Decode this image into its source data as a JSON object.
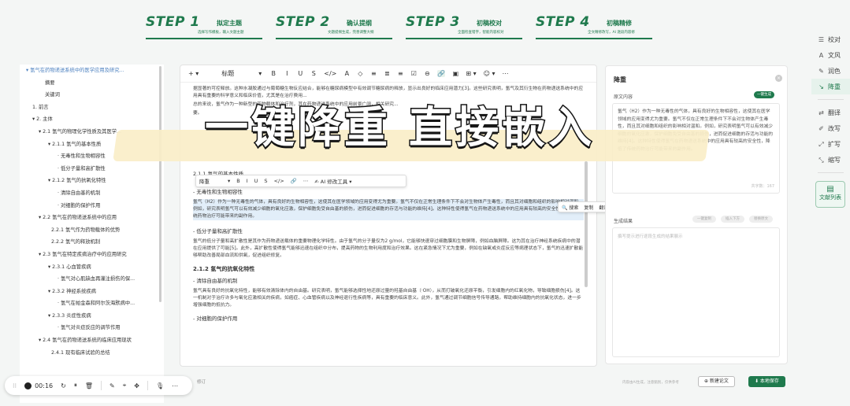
{
  "steps": [
    {
      "num": "STEP 1",
      "title": "拟定主题",
      "sub": "选择写作模板，输入文题主题"
    },
    {
      "num": "STEP 2",
      "title": "确认提纲",
      "sub": "文题提纲生成，完善调整大纲"
    },
    {
      "num": "STEP 3",
      "title": "初稿校对",
      "sub": "全面检查错字，智能内容校对"
    },
    {
      "num": "STEP 4",
      "title": "初稿精修",
      "sub": "全文精修改写，AI 逐段内容修"
    }
  ],
  "rail": {
    "items": [
      {
        "icon": "☰",
        "label": "校对"
      },
      {
        "icon": "A",
        "label": "文风"
      },
      {
        "icon": "✎",
        "label": "润色"
      },
      {
        "icon": "↘",
        "label": "降重"
      },
      {
        "icon": "⇄",
        "label": "翻译"
      },
      {
        "icon": "✐",
        "label": "改写"
      },
      {
        "icon": "⤢",
        "label": "扩写"
      },
      {
        "icon": "⤡",
        "label": "缩写"
      }
    ],
    "card_label": "文献列表"
  },
  "outline": {
    "items": [
      {
        "indent": 0,
        "text": "▾ 氢气在药物递送系统中的医学应用及研究..."
      },
      {
        "indent": 24,
        "text": "摘要"
      },
      {
        "indent": 24,
        "text": "关键词"
      },
      {
        "indent": 8,
        "text": "1. 前言"
      },
      {
        "indent": 8,
        "text": "▾ 2. 主体"
      },
      {
        "indent": 16,
        "text": "▾ 2.1 氢气的物理化学性质及其医学..."
      },
      {
        "indent": 28,
        "text": "▾ 2.1.1 氢气的基本性质"
      },
      {
        "indent": 40,
        "text": "· 无毒性和生物相容性"
      },
      {
        "indent": 40,
        "text": "· 低分子量和高扩散性"
      },
      {
        "indent": 28,
        "text": "▾ 2.1.2 氢气的抗氧化特性"
      },
      {
        "indent": 40,
        "text": "· 清除自由基的机制"
      },
      {
        "indent": 40,
        "text": "· 对细胞的保护作用"
      },
      {
        "indent": 16,
        "text": "▾ 2.2 氢气在药物递送系统中的应用"
      },
      {
        "indent": 32,
        "text": "2.2.1 氢气作为药物载体的优势"
      },
      {
        "indent": 32,
        "text": "2.2.2 氢气的释放机制"
      },
      {
        "indent": 16,
        "text": "▾ 2.3 氢气在特定疾病治疗中的应用研究"
      },
      {
        "indent": 28,
        "text": "▾ 2.3.1 心血管疾病"
      },
      {
        "indent": 40,
        "text": "· 氢气对心肌缺血再灌注损伤的保..."
      },
      {
        "indent": 28,
        "text": "▾ 2.3.2 神经系统疾病"
      },
      {
        "indent": 40,
        "text": "· 氢气在帕金森和阿尔茨海默病中..."
      },
      {
        "indent": 28,
        "text": "▾ 2.3.3 炎症性疾病"
      },
      {
        "indent": 40,
        "text": "· 氢气对炎症反应的调节作用"
      },
      {
        "indent": 16,
        "text": "▾ 2.4 氢气在药物递送系统的临床应用现状"
      },
      {
        "indent": 32,
        "text": "2.4.1 现有临床试验的总结"
      }
    ]
  },
  "toolbar": {
    "items": [
      "+ ▾",
      "标题",
      "▾",
      "B",
      "I",
      "U",
      "S",
      "</>",
      "A",
      "◇",
      "≡",
      "≣",
      "≡",
      "☑",
      "⊖",
      "🔗",
      "▣",
      "⊞ ▾",
      "☺ ▾",
      "⋯"
    ],
    "active_index": 15
  },
  "fbar": {
    "items": [
      "降重",
      "▾",
      "B",
      "I",
      "U",
      "S",
      "</>",
      "🔗",
      "⋯",
      "✍ AI 修改工具 ▾"
    ]
  },
  "cpop": {
    "items": [
      "🔍 搜索",
      "复制",
      "翻译"
    ]
  },
  "doc": {
    "intro": "据显著的可控释放。这种水凝胶通过与葡萄糖生物反应结合，能够在糖尿病模型中有效调节糖尿病的释放，显示出良好的临床应用潜力[3]。这些研究表明，氢气及其衍生物在药物递送系统中的应用具有重要的科学意义和临床价值，尤其是在治疗费用...",
    "intro2": "总的来说，氢气作为一种新型的药物载体和治疗剂，其在药物递送系统中的应用前景广阔，相关研究...",
    "intro3": "要。",
    "h_basic": "2.1.1 氢气的基本性质",
    "h_nontoxic": "- 无毒性和生物相容性",
    "p_nontoxic": "氢气（H2）作为一种无毒性的气体，具有良好的生物相容性，这使其在医学领域的应用变得尤为重要。氢气不仅在正常生理条件下不会对生物体产生毒性，而且其对细胞和组织的影响相对温和。例如，研究表明氢气可以有效减少细胞的氧化应激，保护细胞免受自由基的损伤，进而促进细胞的存活与功能的维持[4]。这种特性使得氢气在药物递送系统中的应用具有较高的安全性，降低了传统药物治疗可能带来的副作用。",
    "h_lowmw": "- 低分子量和高扩散性",
    "p_lowmw": "氢气的低分子量和高扩散性是其作为药物递送载体的重要物理化学特性。由于氢气的分子量仅为2 g/mol，它能够快速穿过细胞膜和生物屏障，例如血脑屏障。这为其在治疗神经系统疾病中的潜在应用提供了可能[5]。此外，高扩散性使得氢气能够迅速在组织中分布，提高药物的生物利用度和治疗效果。这在紧急情况下尤为重要，例如在缺氧或炎症反应等病理状态下，氢气的迅速扩散能够帮助改善局部血流和供氧，促进组织修复。",
    "h_antiox": "2.1.2 氢气的抗氧化特性",
    "h_scav": "- 清除自由基的机制",
    "p_scav": "氢气具有良好的抗氧化特性，能够有效清除体内的自由基。研究表明，氢气能够选择性地还原过量的羟基自由基（·OH），从而打破氧化还原平衡，引发细胞内的红氧化物，导致细胞损伤[4]。这一机制对于治疗许多与氧化应激相关的疾病，如癌症、心血管疾病以及神经退行性疾病等，具有重要的临床意义。此外，氢气通过调节细胞信号传导通路，帮助维持细胞内的抗氧化状态，进一步增强细胞的抵抗力。",
    "h_protect": "- 对细胞的保护作用"
  },
  "panel": {
    "title": "降重",
    "source_label": "原文内容",
    "gen_label": "一键生成",
    "source_text": "氢气（H2）作为一种无毒性的气体，具有良好的生物相容性，这使其在医学领域的应用变得尤为重要。氢气不仅在正常生理条件下不会对生物体产生毒性，而且其对细胞和组织的影响相对温和。例如，研究表明氢气可以有效减少细胞的氧化应激，保护细胞免受自由基的损伤，进而促进细胞的存活与功能的维持[4]。这种特性使得氢气在药物递送系统中的应用具有较高的安全性，降低了传统药物治疗可能带来的副作用。",
    "count": "共字数：167",
    "result_label": "生成结果",
    "result_btns": [
      "一键复制",
      "插入下方",
      "替换原文"
    ],
    "result_placeholder": "撰写提示进行逐段生成的结果展示"
  },
  "footer": {
    "left": "修订",
    "hint": "内容由AI生成，注意甄别，仅供参考",
    "new_btn": "⊕ 新建论文",
    "save_btn": "⬇ 本地保存"
  },
  "recorder": {
    "handle": "⁝⁝",
    "time": "00:16",
    "icons": [
      "↻",
      "⏸",
      "🗑",
      "✎",
      "⌖",
      "✥",
      "🎙",
      "⋯"
    ]
  },
  "overlay": {
    "text": "一键降重 直接嵌入"
  }
}
